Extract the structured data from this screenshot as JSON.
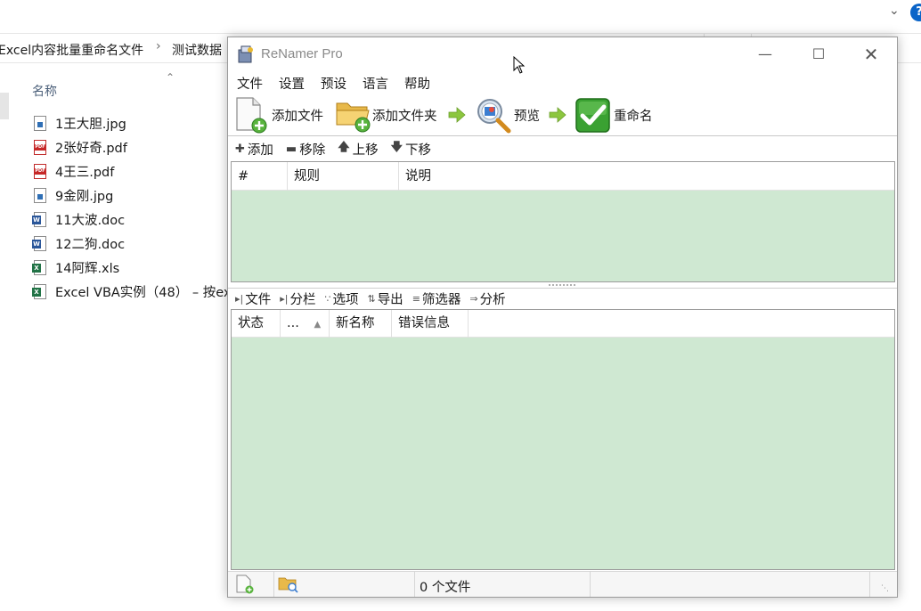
{
  "explorer": {
    "breadcrumb": [
      "Excel内容批量重命名文件",
      "测试数据"
    ],
    "breadcrumb_separator": "›",
    "column_header": "名称",
    "help_label": "?",
    "files": [
      {
        "name": "1王大胆.jpg",
        "icon": "jpg-file-icon"
      },
      {
        "name": "2张好奇.pdf",
        "icon": "pdf-file-icon"
      },
      {
        "name": "4王三.pdf",
        "icon": "pdf-file-icon"
      },
      {
        "name": "9金刚.jpg",
        "icon": "jpg-file-icon"
      },
      {
        "name": "11大波.doc",
        "icon": "word-file-icon"
      },
      {
        "name": "12二狗.doc",
        "icon": "word-file-icon"
      },
      {
        "name": "14阿辉.xls",
        "icon": "excel-file-icon"
      },
      {
        "name": "Excel VBA实例（48） – 按ex",
        "icon": "excel-file-icon"
      }
    ]
  },
  "renamer": {
    "title": "ReNamer Pro",
    "menu": [
      "文件",
      "设置",
      "预设",
      "语言",
      "帮助"
    ],
    "toolbar": {
      "add_files": "添加文件",
      "add_folders": "添加文件夹",
      "preview": "预览",
      "rename": "重命名"
    },
    "rules_bar": {
      "add": "添加",
      "remove": "移除",
      "up": "上移",
      "down": "下移"
    },
    "rules_columns": [
      "#",
      "规则",
      "说明"
    ],
    "files_bar": [
      "文件",
      "分栏",
      "选项",
      "导出",
      "筛选器",
      "分析"
    ],
    "files_columns": [
      "状态",
      "...",
      "新名称",
      "错误信息"
    ],
    "status_text": "0 个文件",
    "colors": {
      "grid_bg": "#cfe8d2",
      "arrow_green": "#8cc63f",
      "check_green": "#3aa132"
    }
  }
}
